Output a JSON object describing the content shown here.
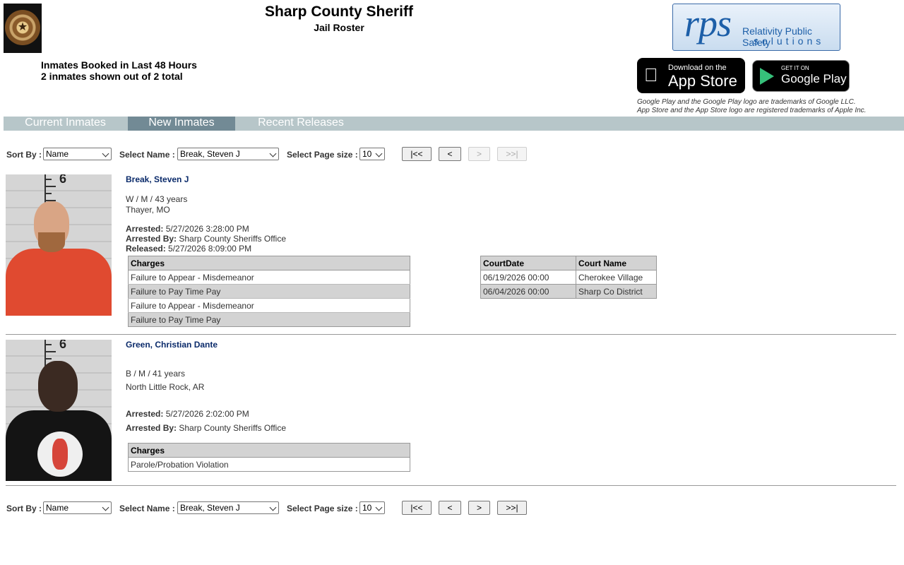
{
  "header": {
    "title": "Sharp County Sheriff",
    "subtitle": "Jail Roster",
    "booked_heading": "Inmates Booked in Last 48 Hours",
    "shown_count": "2 inmates shown out of 2 total",
    "rps_logo": {
      "big": "rps",
      "line1": "Relativity Public Safety",
      "line2": "solutions"
    },
    "app_store": {
      "small": "Download on the",
      "big": "App Store"
    },
    "google_play": {
      "small": "GET IT ON",
      "big": "Google Play"
    },
    "trademark_line1": "Google Play and the Google Play logo are trademarks of Google LLC.",
    "trademark_line2": "App Store and the App Store logo are registered trademarks of Apple Inc."
  },
  "nav": {
    "tabs": [
      {
        "label": "Current Inmates",
        "active": false
      },
      {
        "label": "New Inmates",
        "active": true
      },
      {
        "label": "Recent Releases",
        "active": false
      }
    ]
  },
  "paging": {
    "sort_by_label": "Sort By :",
    "sort_by_value": "Name",
    "select_name_label": "Select Name :",
    "select_name_value": "Break, Steven J",
    "page_size_label": "Select Page size :",
    "page_size_value": "10",
    "first": "|<<",
    "prev": "<",
    "next": ">",
    "last": ">>|"
  },
  "inmates": [
    {
      "name": "Break, Steven J",
      "demographics": "W / M / 43 years",
      "location": "Thayer, MO",
      "arrested_label": "Arrested:",
      "arrested": "5/27/2026 3:28:00 PM",
      "arrested_by_label": "Arrested By:",
      "arrested_by": "Sharp County Sheriffs Office",
      "released_label": "Released:",
      "released": "5/27/2026 8:09:00 PM",
      "charges_header": "Charges",
      "charges": [
        "Failure to Appear - Misdemeanor",
        "Failure to Pay Time Pay",
        "Failure to Appear - Misdemeanor",
        "Failure to Pay Time Pay"
      ],
      "court_headers": [
        "CourtDate",
        "Court Name"
      ],
      "courts": [
        {
          "date": "06/19/2026 00:00",
          "name": "Cherokee Village"
        },
        {
          "date": "06/04/2026 00:00",
          "name": "Sharp Co District"
        }
      ]
    },
    {
      "name": "Green, Christian Dante",
      "demographics": "B / M / 41 years",
      "location": "North Little Rock, AR",
      "arrested_label": "Arrested:",
      "arrested": "5/27/2026 2:02:00 PM",
      "arrested_by_label": "Arrested By:",
      "arrested_by": "Sharp County Sheriffs Office",
      "charges_header": "Charges",
      "charges": [
        "Parole/Probation Violation"
      ]
    }
  ],
  "colors": {
    "nav_bar": "#b7c6c9",
    "active_tab": "#728a95",
    "name_link": "#0a2a6a"
  }
}
